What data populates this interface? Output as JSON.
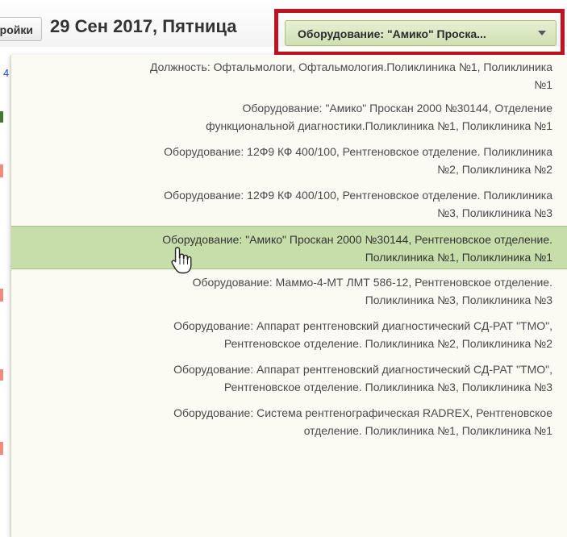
{
  "header": {
    "settings_button_label": "Настройки",
    "date_title": "29 Сен 2017, Пятница",
    "link_fragment": "4"
  },
  "equipment_select": {
    "selected_label": "Оборудование: \"Амико\" Проска...",
    "highlight_color": "#c1121f"
  },
  "dropdown": {
    "items": [
      {
        "line1": "Должность: Офтальмологи, Офтальмология.Поликлиника №1, Поликлиника",
        "line2": "№1"
      },
      {
        "line1": "Оборудование: \"Амико\" Проскан 2000 №30144, Отделение",
        "line2": "функциональной диагностики.Поликлиника №1, Поликлиника №1"
      },
      {
        "line1": "Оборудование: 12Ф9 КФ 400/100, Рентгеновское отделение. Поликлиника",
        "line2": "№2, Поликлиника №2"
      },
      {
        "line1": "Оборудование: 12Ф9 КФ 400/100, Рентгеновское отделение. Поликлиника",
        "line2": "№3, Поликлиника №3"
      },
      {
        "line1": "Оборудование: \"Амико\" Проскан 2000 №30144, Рентгеновское отделение.",
        "line2": "Поликлиника №1, Поликлиника №1"
      },
      {
        "line1": "Оборудование: Маммо-4-МТ ЛМТ 586-12, Рентгеновское отделение.",
        "line2": "Поликлиника №3, Поликлиника №3"
      },
      {
        "line1": "Оборудование: Аппарат рентгеновский диагностический СД-РАТ \"ТМО\",",
        "line2": "Рентгеновское отделение. Поликлиника №2, Поликлиника №2"
      },
      {
        "line1": "Оборудование: Аппарат рентгеновский диагностический СД-РАТ \"ТМО\",",
        "line2": "Рентгеновское отделение. Поликлиника №3, Поликлиника №3"
      },
      {
        "line1": "Оборудование: Система рентгенографическая RADREX, Рентгеновское",
        "line2": "отделение. Поликлиника №1, Поликлиника №1"
      }
    ],
    "active_index": 4,
    "active_color": "#c7deaa"
  }
}
